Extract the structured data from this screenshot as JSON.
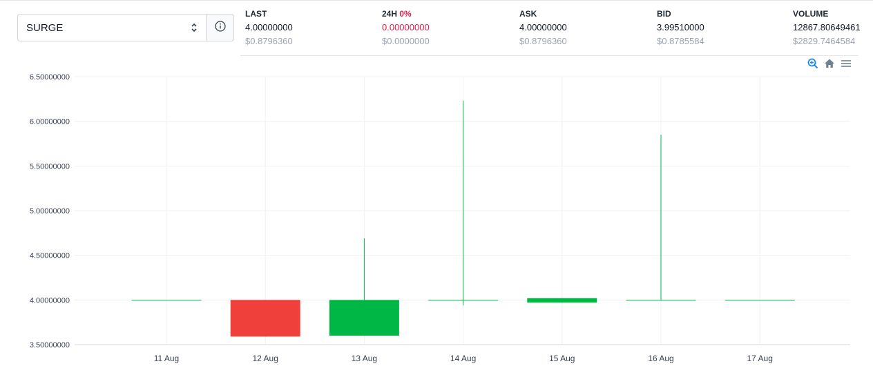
{
  "market": {
    "selected": "SURGE"
  },
  "stats": {
    "last": {
      "label": "LAST",
      "value": "4.00000000",
      "usd": "$0.8796360"
    },
    "change": {
      "label": "24H",
      "percent": "0%",
      "value": "0.00000000",
      "usd": "$0.0000000"
    },
    "ask": {
      "label": "ASK",
      "value": "4.00000000",
      "usd": "$0.8796360"
    },
    "bid": {
      "label": "BID",
      "value": "3.99510000",
      "usd": "$0.8785584"
    },
    "volume": {
      "label": "VOLUME",
      "value": "12867.80649461",
      "usd": "$2829.7464584"
    }
  },
  "toolbar": {
    "icons": [
      "zoom-in-icon",
      "home-icon",
      "menu-icon"
    ]
  },
  "colors": {
    "up": "#00b746",
    "down": "#ef403c",
    "accent": "#e11d48",
    "zoom": "#1e88e5",
    "grid": "#eef0f3"
  },
  "chart_data": {
    "type": "candlestick",
    "categories": [
      "11 Aug",
      "12 Aug",
      "13 Aug",
      "14 Aug",
      "15 Aug",
      "16 Aug",
      "17 Aug"
    ],
    "series": [
      {
        "values": [
          {
            "open": 4.0,
            "high": 4.0,
            "low": 4.0,
            "close": 4.0
          },
          {
            "open": 4.0,
            "high": 4.0,
            "low": 3.59,
            "close": 3.59
          },
          {
            "open": 3.6,
            "high": 4.69,
            "low": 3.6,
            "close": 4.0
          },
          {
            "open": 4.0,
            "high": 6.23,
            "low": 3.94,
            "close": 4.0
          },
          {
            "open": 3.97,
            "high": 4.02,
            "low": 3.97,
            "close": 4.02
          },
          {
            "open": 4.0,
            "high": 5.85,
            "low": 4.0,
            "close": 4.0
          },
          {
            "open": 4.0,
            "high": 4.0,
            "low": 4.0,
            "close": 4.0
          }
        ]
      }
    ],
    "yticks": [
      "6.50000000",
      "6.00000000",
      "5.50000000",
      "5.00000000",
      "4.50000000",
      "4.00000000",
      "3.50000000"
    ],
    "ylim": [
      3.5,
      6.5
    ],
    "grid": true
  }
}
